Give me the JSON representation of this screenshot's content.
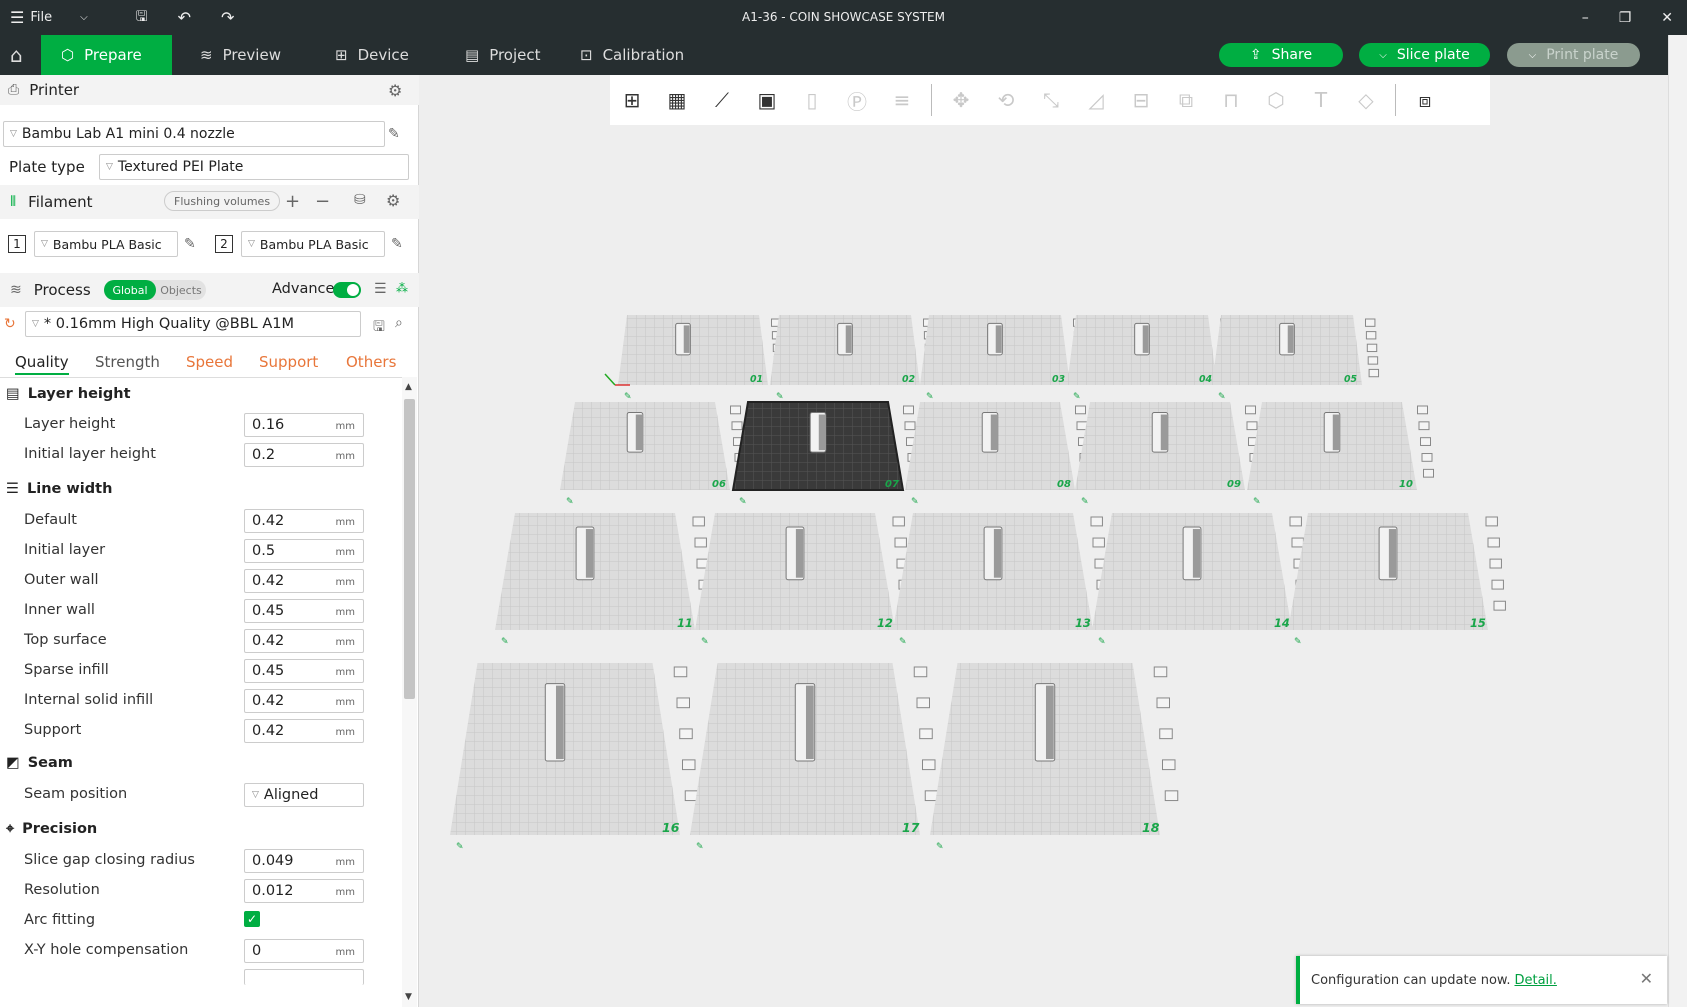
{
  "titlebar": {
    "file_label": "File",
    "title": "A1-36 - COIN SHOWCASE SYSTEM"
  },
  "menubar": {
    "tabs": [
      {
        "label": "Prepare"
      },
      {
        "label": "Preview"
      },
      {
        "label": "Device"
      },
      {
        "label": "Project"
      },
      {
        "label": "Calibration"
      }
    ],
    "share_label": "Share",
    "slice_label": "Slice plate",
    "print_label": "Print plate"
  },
  "printer": {
    "header": "Printer",
    "name": "Bambu Lab A1 mini 0.4 nozzle",
    "plate_type_label": "Plate type",
    "plate_type": "Textured PEI Plate"
  },
  "filament": {
    "header": "Filament",
    "flushing_label": "Flushing volumes",
    "slots": [
      {
        "num": "1",
        "name": "Bambu PLA Basic"
      },
      {
        "num": "2",
        "name": "Bambu PLA Basic"
      }
    ]
  },
  "process": {
    "header": "Process",
    "global_label": "Global",
    "objects_label": "Objects",
    "advance_label": "Advance",
    "preset": "* 0.16mm High Quality @BBL A1M"
  },
  "subtabs": [
    {
      "label": "Quality"
    },
    {
      "label": "Strength"
    },
    {
      "label": "Speed"
    },
    {
      "label": "Support"
    },
    {
      "label": "Others"
    }
  ],
  "sections": {
    "layer_height": "Layer height",
    "line_width": "Line width",
    "seam": "Seam",
    "precision": "Precision"
  },
  "params": [
    {
      "label": "Layer height",
      "value": "0.16",
      "unit": "mm"
    },
    {
      "label": "Initial layer height",
      "value": "0.2",
      "unit": "mm"
    },
    {
      "label": "Default",
      "value": "0.42",
      "unit": "mm"
    },
    {
      "label": "Initial layer",
      "value": "0.5",
      "unit": "mm"
    },
    {
      "label": "Outer wall",
      "value": "0.42",
      "unit": "mm"
    },
    {
      "label": "Inner wall",
      "value": "0.45",
      "unit": "mm"
    },
    {
      "label": "Top surface",
      "value": "0.42",
      "unit": "mm"
    },
    {
      "label": "Sparse infill",
      "value": "0.45",
      "unit": "mm"
    },
    {
      "label": "Internal solid infill",
      "value": "0.42",
      "unit": "mm"
    },
    {
      "label": "Support",
      "value": "0.42",
      "unit": "mm"
    },
    {
      "label": "Seam position",
      "value": "Aligned",
      "unit": ""
    },
    {
      "label": "Slice gap closing radius",
      "value": "0.049",
      "unit": "mm"
    },
    {
      "label": "Resolution",
      "value": "0.012",
      "unit": "mm"
    },
    {
      "label": "Arc fitting",
      "value": "",
      "unit": ""
    },
    {
      "label": "X-Y hole compensation",
      "value": "0",
      "unit": "mm"
    }
  ],
  "plates": [
    "01",
    "02",
    "03",
    "04",
    "05",
    "06",
    "07",
    "08",
    "09",
    "10",
    "11",
    "12",
    "13",
    "14",
    "15",
    "16",
    "17",
    "18"
  ],
  "notification": {
    "text": "Configuration can update now.",
    "link": "Detail."
  },
  "colors": {
    "accent": "#00ae42",
    "titlebar": "#262e30",
    "orange": "#e8763a"
  }
}
